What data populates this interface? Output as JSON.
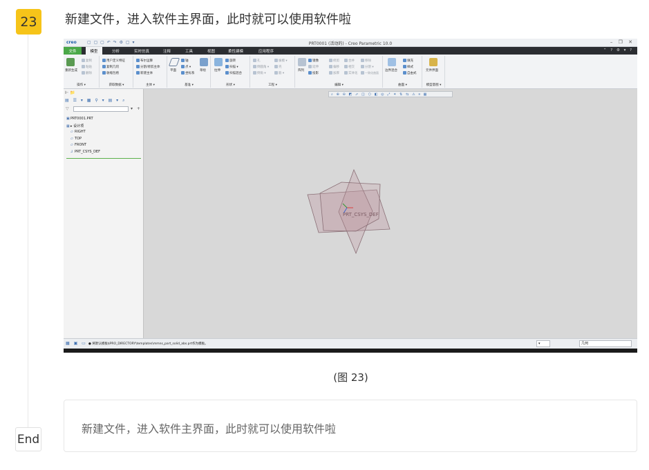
{
  "step": {
    "number": "23",
    "title": "新建文件，进入软件主界面，此时就可以使用软件啦"
  },
  "screenshot": {
    "app": {
      "logo": "creo",
      "quick_access": "▢ ▢ ▢ ↶ ↷ ⚙ ▢ ▾",
      "window_title": "PRT0001 (活动的) - Creo Parametric 10.0",
      "window_controls": "– ❐ ✕"
    },
    "tabs": [
      {
        "label": "文件"
      },
      {
        "label": "模型"
      },
      {
        "label": "分析"
      },
      {
        "label": "实时仿真"
      },
      {
        "label": "注释"
      },
      {
        "label": "工具"
      },
      {
        "label": "视图"
      },
      {
        "label": "柔性建模"
      },
      {
        "label": "应用程序"
      }
    ],
    "ribbon_right": "⌃ ? ⚙ ▾ ?",
    "ribbon": {
      "groups": [
        {
          "label": "操作 ▾",
          "items": [
            "重新生成",
            "复制",
            "粘贴",
            "删除"
          ]
        },
        {
          "label": "获取数据 ▾",
          "items": [
            "用户定义特征",
            "复制几何",
            "收缩包络"
          ]
        },
        {
          "label": "主体 ▾",
          "items": [
            "布尔运算",
            "分割/修剪主体",
            "新建主体"
          ]
        },
        {
          "label": "基准 ▾",
          "items": [
            "平面",
            "轴",
            "点 ▾",
            "坐标系",
            "草绘"
          ]
        },
        {
          "label": "形状 ▾",
          "items": [
            "拉伸",
            "旋转",
            "扫描 ▾",
            "扫描混合"
          ]
        },
        {
          "label": "工程 ▾",
          "items": [
            "孔",
            "倒圆角 ▾",
            "倒角 ▾",
            "拔模 ▾",
            "壳",
            "筋 ▾"
          ]
        },
        {
          "label": "编辑 ▾",
          "items": [
            "阵列",
            "镜像",
            "延伸",
            "投影",
            "修剪",
            "偏移",
            "加厚",
            "合并",
            "相交",
            "实体化",
            "移除",
            "分割 ▾",
            "一致化曲面"
          ]
        },
        {
          "label": "曲面 ▾",
          "items": [
            "边界混合",
            "填充",
            "样式",
            "自由式"
          ]
        },
        {
          "label": "模型意图 ▾",
          "items": [
            "元件界面"
          ]
        }
      ]
    },
    "model_tree": {
      "tools": "▤ ☰ ▾ ▦ ⚲ ▾ ▤ ▾ ⌕",
      "nodes": [
        {
          "icon": "▣",
          "label": "PRT0001.PRT"
        },
        {
          "icon": "▦",
          "label": "▸ 设计项"
        },
        {
          "icon": "▱",
          "label": "RIGHT"
        },
        {
          "icon": "▱",
          "label": "TOP"
        },
        {
          "icon": "▱",
          "label": "FRONT"
        },
        {
          "icon": "⅃",
          "label": "PRT_CSYS_DEF"
        }
      ]
    },
    "view_toolbar": "⌕ ⊕ ⊖ ◩ ⬀ ◫ ⬡ ◧ ◎ ⤢ ✶ ⇅ ⇆ ⚠ ⏸ ▦",
    "csys_label": "PRT_CSYS_DEF",
    "status": {
      "icons": "▦ ▣ ▭",
      "message": "● 将默认模板$PRO_DIRECTORY\\templates\\mmns_part_solid_abs.prt作为模板。",
      "select1": "▾",
      "select2": "几何"
    }
  },
  "caption": "(图 23)",
  "note": "新建文件，进入软件主界面，此时就可以使用软件啦",
  "end_label": "End"
}
